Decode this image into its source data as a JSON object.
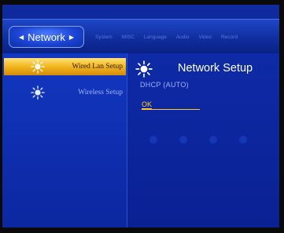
{
  "topbar": {
    "active_tab": "Network",
    "tabs": [
      "System",
      "MISC",
      "Language",
      "Audio",
      "Video",
      "Record"
    ]
  },
  "left_menu": {
    "items": [
      {
        "label": "Wired Lan Setup",
        "selected": true,
        "icon": "sun-icon"
      },
      {
        "label": "Wireless Setup",
        "selected": false,
        "icon": "sun-icon"
      }
    ]
  },
  "panel": {
    "title": "Network Setup",
    "icon": "sun-icon",
    "mode": "DHCP (AUTO)",
    "ok_label": "OK"
  },
  "colors": {
    "accent": "#f2b51d",
    "background": "#0a2193",
    "ok_text": "#ffcb2b"
  }
}
